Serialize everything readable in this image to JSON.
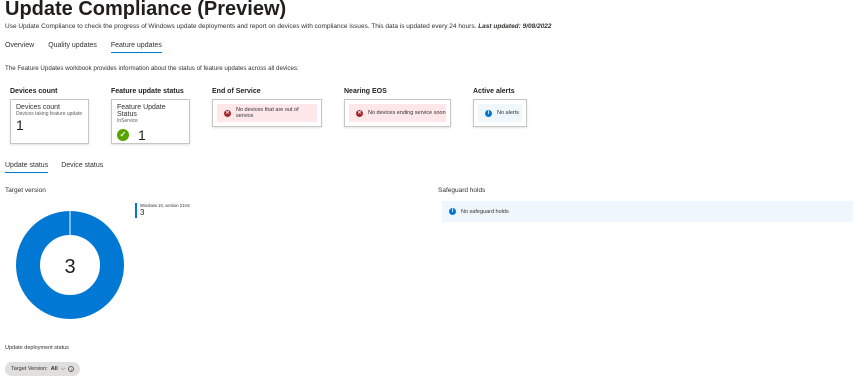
{
  "header": {
    "title": "Update Compliance (Preview)",
    "description": "Use Update Compliance to check the progress of Windows update deployments and report on devices with compliance issues. This data is updated every 24 hours.",
    "last_updated": "Last updated: 9/08/2022"
  },
  "tabs": [
    "Overview",
    "Quality updates",
    "Feature updates"
  ],
  "intro": "The Feature Updates workbook provides information about the status of feature updates across all devices:",
  "tiles": {
    "devices_count": {
      "group": "Devices count",
      "title": "Devices count",
      "subtitle": "Devices taking feature update",
      "value": "1"
    },
    "feature_status": {
      "group": "Feature update status",
      "title": "Feature Update Status",
      "subtitle": "InService",
      "value": "1"
    },
    "end_of_service": {
      "group": "End of Service",
      "message": "No devices that are out of service"
    },
    "nearing_eos": {
      "group": "Nearing EOS",
      "message": "No devices ending service soon"
    },
    "active_alerts": {
      "group": "Active alerts",
      "message": "No alerts"
    }
  },
  "subtabs": [
    "Update status",
    "Device status"
  ],
  "target_version": {
    "label": "Target version",
    "center_value": "3"
  },
  "chart_data": {
    "type": "pie",
    "categories": [
      "Windows 10, version 21H2"
    ],
    "values": [
      3
    ],
    "title": "Target version",
    "colors": [
      "#0078d4"
    ],
    "legend_placement": "top-right"
  },
  "safeguard": {
    "label": "Safeguard holds",
    "message": "No safeguard holds"
  },
  "deployment": {
    "label": "Update deployment status",
    "filter_label": "Target Version:",
    "filter_value": "All"
  },
  "colors": {
    "accent": "#0078d4",
    "success": "#57a300",
    "error": "#a4262c",
    "error_bg": "#fde7e9",
    "info_bg": "#eff6fc"
  }
}
